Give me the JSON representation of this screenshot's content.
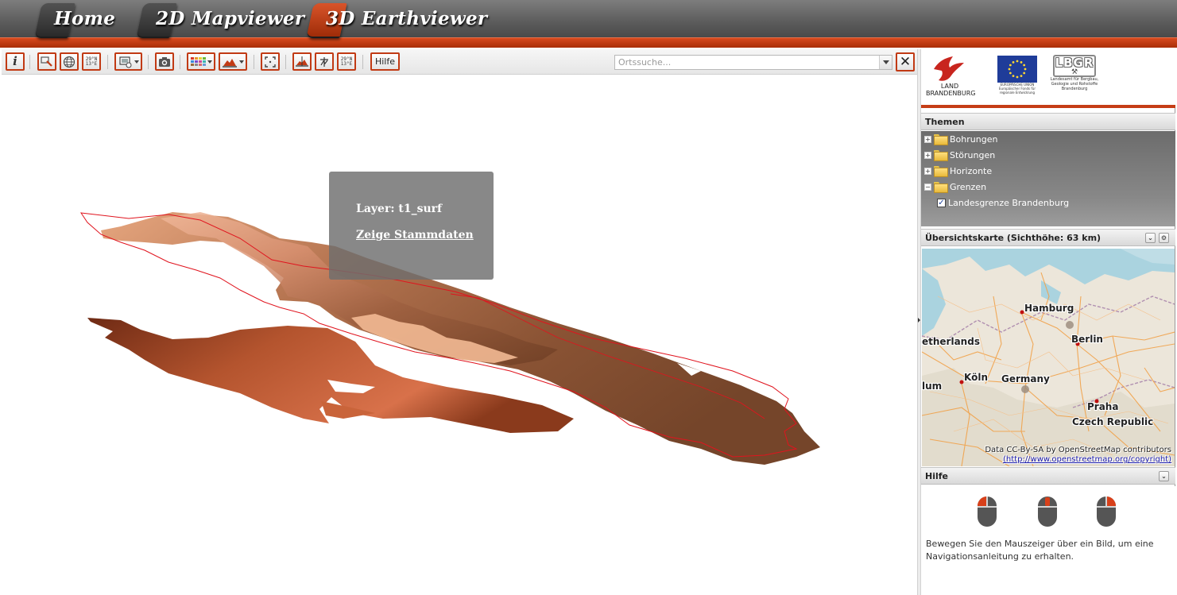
{
  "nav": {
    "tabs": [
      {
        "label": "Home",
        "active": false
      },
      {
        "label": "2D Mapviewer",
        "active": false
      },
      {
        "label": "3D Earthviewer",
        "active": true
      }
    ]
  },
  "toolbar": {
    "coord_button_1": {
      "lat": "29°N",
      "lon": "13°E"
    },
    "coord_button_2": {
      "lat": "29°N",
      "lon": "13°E"
    },
    "help_label": "Hilfe",
    "search_placeholder": "Ortssuche..."
  },
  "popup": {
    "layer_text": "Layer: t1_surf",
    "link_text": "Zeige Stammdaten"
  },
  "logos": {
    "brandenburg_line1": "LAND",
    "brandenburg_line2": "BRANDENBURG",
    "eu_line1": "EUROPÄISCHE UNION",
    "eu_line2": "Europäischer Fonds für regionale Entwicklung",
    "lbgr_mark": "LBGR",
    "lbgr_caption": "Landesamt für Bergbau, Geologie und Rohstoffe Brandenburg"
  },
  "themes": {
    "title": "Themen",
    "items": [
      {
        "label": "Bohrungen",
        "expander": "+"
      },
      {
        "label": "Störungen",
        "expander": "+"
      },
      {
        "label": "Horizonte",
        "expander": "+"
      },
      {
        "label": "Grenzen",
        "expander": "−"
      }
    ],
    "child": {
      "label": "Landesgrenze Brandenburg",
      "checked": true
    }
  },
  "overview": {
    "title": "Übersichtskarte (Sichthöhe: 63 km)",
    "cities": [
      "Hamburg",
      "etherlands",
      "Berlin",
      "Köln",
      "Germany",
      "lum",
      "Praha",
      "Czech Republic"
    ],
    "attribution_line1": "Data CC-By-SA by OpenStreetMap contributors",
    "attribution_link": "(http://www.openstreetmap.org/copyright)"
  },
  "help": {
    "title": "Hilfe",
    "text": "Bewegen Sie den Mauszeiger über ein Bild, um eine Navigationsanleitung zu erhalten."
  },
  "colors": {
    "accent": "#c53d16",
    "surface_light": "#e6a77f",
    "surface_dark": "#8a4a2a",
    "boundary_line": "#e0141e"
  }
}
